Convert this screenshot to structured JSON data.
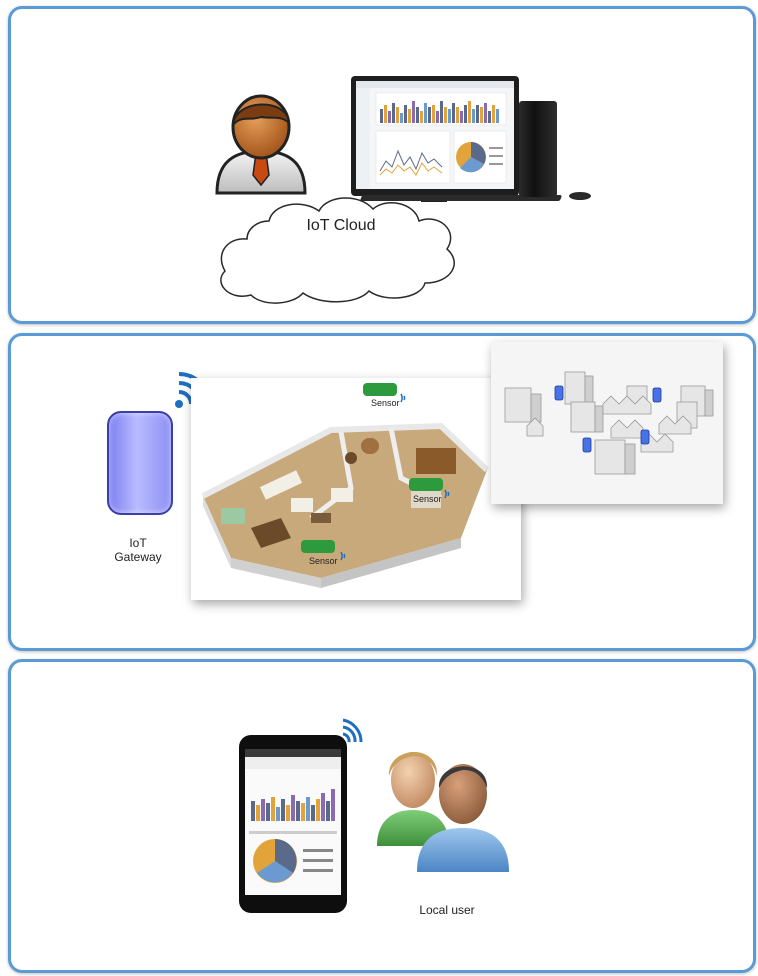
{
  "tiers": {
    "cloud": {
      "label": "IoT Cloud"
    },
    "gateway": {
      "label_line1": "IoT",
      "label_line2": "Gateway",
      "sensors": [
        "Sensor",
        "Sensor",
        "Sensor"
      ]
    },
    "local": {
      "label": "Local user"
    }
  },
  "colors": {
    "panel_border": "#5b9bd5",
    "sensor_green": "#2e9a3e",
    "gateway_purple": "#8e90f5",
    "wifi_blue": "#1f6fc0"
  },
  "icons": [
    "user-avatar-icon",
    "desktop-computer-icon",
    "cloud-icon",
    "wifi-signal-icon",
    "gateway-device-icon",
    "floorplan-image",
    "city-buildings-image",
    "smartphone-icon",
    "local-users-icon"
  ]
}
